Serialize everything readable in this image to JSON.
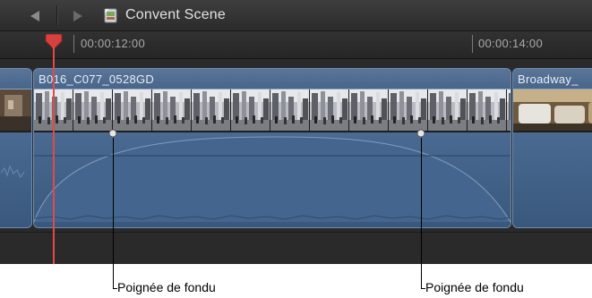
{
  "title_bar": {
    "back_icon": "back-arrow-icon",
    "forward_icon": "forward-arrow-icon",
    "project_icon": "project-clapper-icon",
    "title": "Convent Scene"
  },
  "ruler": {
    "timecodes": [
      "00:00:12:00",
      "00:00:14:00"
    ]
  },
  "clips": [
    {
      "name": ""
    },
    {
      "name": "B016_C077_0528GD"
    },
    {
      "name": "Broadway_"
    }
  ],
  "colors": {
    "playhead": "#e24a4a",
    "clip_fill": "#3d5879",
    "clip_border": "#6f8cb0",
    "background": "#2c2c2c"
  },
  "callouts": {
    "left": "Poignée de fondu",
    "right": "Poignée de fondu"
  }
}
